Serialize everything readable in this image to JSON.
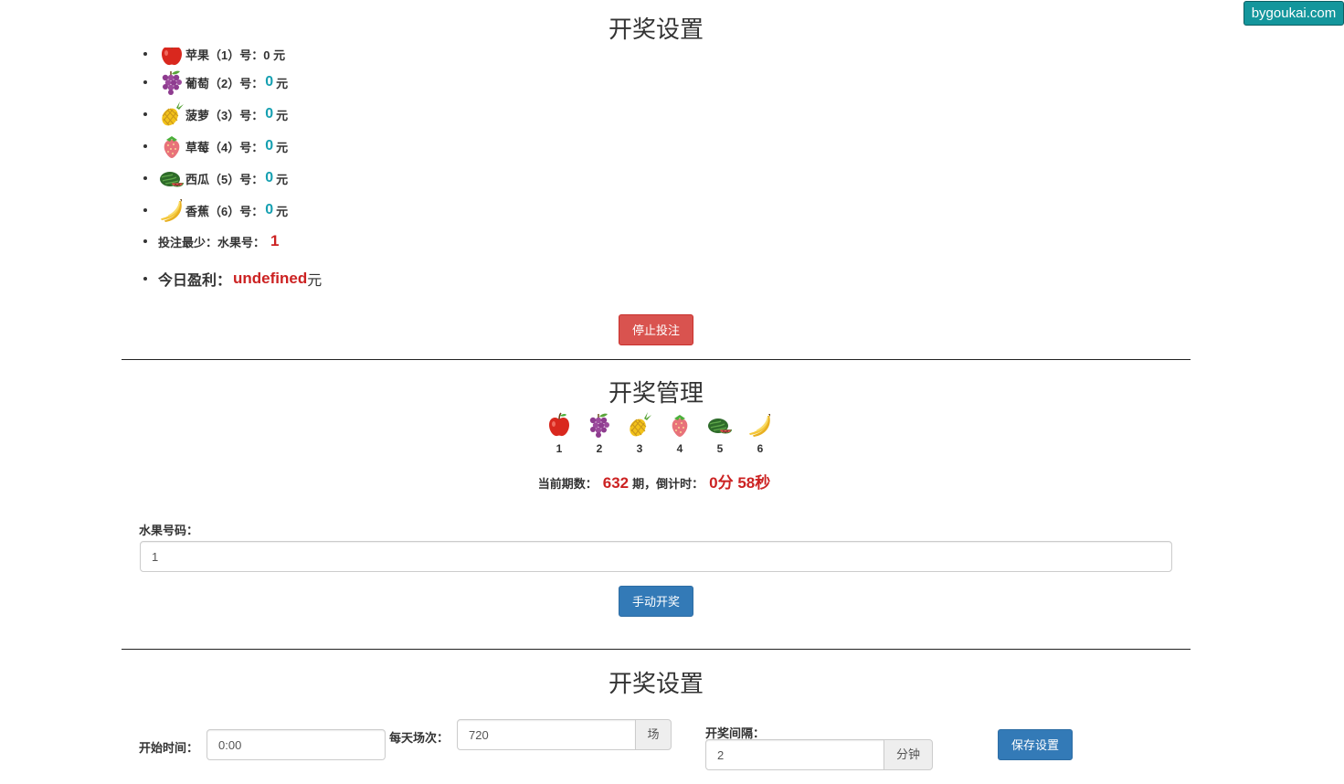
{
  "watermark": "bygoukai.com",
  "settings_top": {
    "title": "开奖设置",
    "partial_item": "苹果（1）号：0 元",
    "items": [
      {
        "icon": "grape-icon",
        "name": "葡萄（2）号：",
        "amount": "0",
        "unit": "元"
      },
      {
        "icon": "pineapple-icon",
        "name": "菠萝（3）号：",
        "amount": "0",
        "unit": "元"
      },
      {
        "icon": "strawberry-icon",
        "name": "草莓（4）号：",
        "amount": "0",
        "unit": "元"
      },
      {
        "icon": "watermelon-icon",
        "name": "西瓜（5）号：",
        "amount": "0",
        "unit": "元"
      },
      {
        "icon": "banana-icon",
        "name": "香蕉（6）号：",
        "amount": "0",
        "unit": "元"
      }
    ],
    "min_bet_label": "投注最少：水果号：",
    "min_bet_value": "1",
    "profit_label": "今日盈利：",
    "profit_value": "undefined",
    "profit_unit": "元",
    "stop_button": "停止投注"
  },
  "manage": {
    "title": "开奖管理",
    "fruits": [
      {
        "icon": "apple-icon",
        "num": "1"
      },
      {
        "icon": "grape-icon",
        "num": "2"
      },
      {
        "icon": "pineapple-icon",
        "num": "3"
      },
      {
        "icon": "strawberry-icon",
        "num": "4"
      },
      {
        "icon": "watermelon-icon",
        "num": "5"
      },
      {
        "icon": "banana-icon",
        "num": "6"
      }
    ],
    "period_label": "当前期数：",
    "period_value": "632",
    "period_suffix": "期，倒计时：",
    "countdown": "0分 58秒",
    "fruit_code_label": "水果号码：",
    "fruit_code_value": "1",
    "manual_button": "手动开奖"
  },
  "settings_bottom": {
    "title": "开奖设置",
    "start_label": "开始时间：",
    "start_value": "0:00",
    "daily_label": "每天场次：",
    "daily_value": "720",
    "daily_unit": "场",
    "interval_label": "开奖间隔：",
    "interval_value": "2",
    "interval_unit": "分钟",
    "save_button": "保存设置"
  },
  "colors": {
    "accent_amount": "#16a0b1",
    "accent_red": "#cc2222",
    "danger": "#d9534f",
    "primary": "#337ab7"
  }
}
